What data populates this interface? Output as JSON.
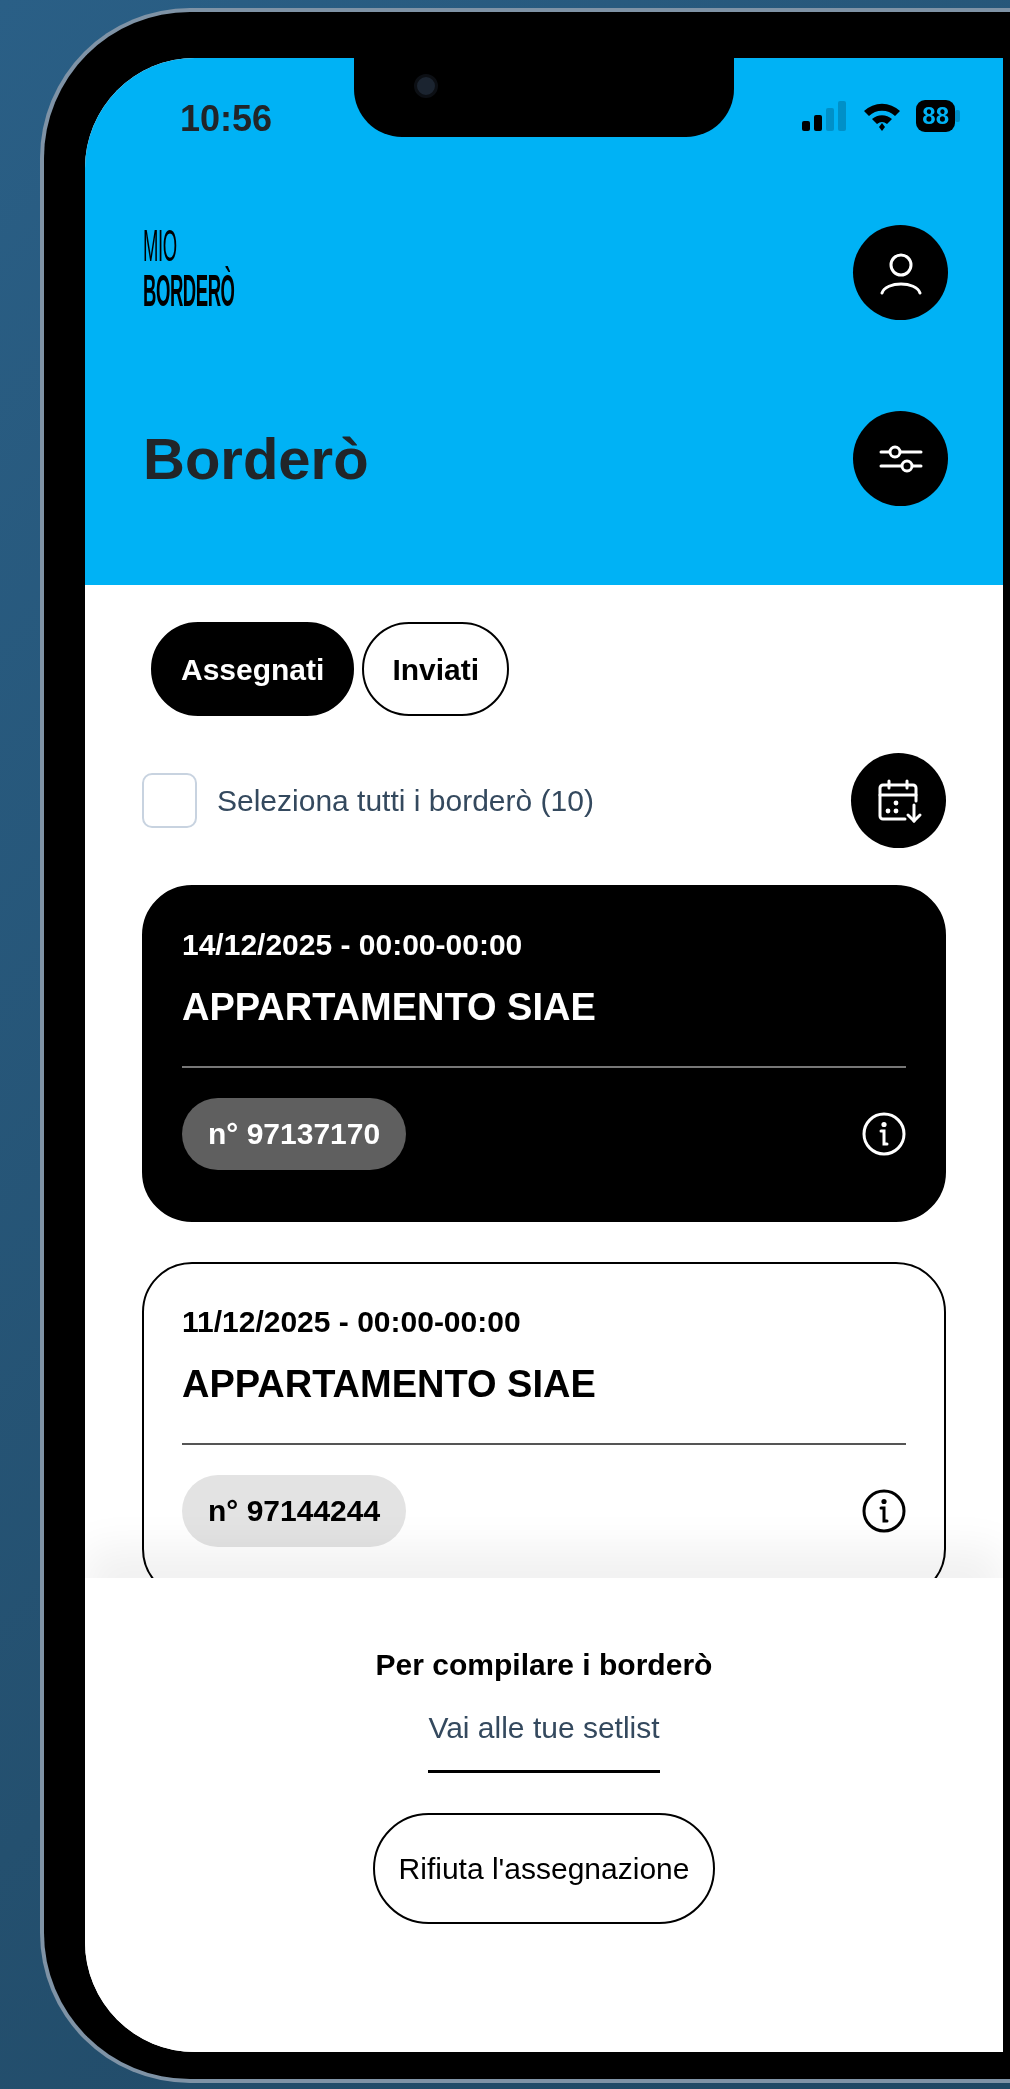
{
  "status_bar": {
    "time": "10:56",
    "battery": "88"
  },
  "header": {
    "logo": [
      "MIO",
      "BORDERÒ"
    ],
    "title": "Borderò"
  },
  "tabs": [
    {
      "label": "Assegnati",
      "selected": true
    },
    {
      "label": "Inviati",
      "selected": false
    }
  ],
  "select_all": {
    "label": "Seleziona tutti i borderò (10)",
    "checked": false
  },
  "cards": [
    {
      "date": "14/12/2025 - 00:00-00:00",
      "title": "APPARTAMENTO SIAE",
      "number": "n° 97137170",
      "selected": true
    },
    {
      "date": "11/12/2025 - 00:00-00:00",
      "title": "APPARTAMENTO SIAE",
      "number": "n° 97144244",
      "selected": false
    }
  ],
  "footer": {
    "hint": "Per compilare i borderò",
    "link": "Vai alle tue setlist",
    "button": "Rifiuta l'assegnazione"
  }
}
